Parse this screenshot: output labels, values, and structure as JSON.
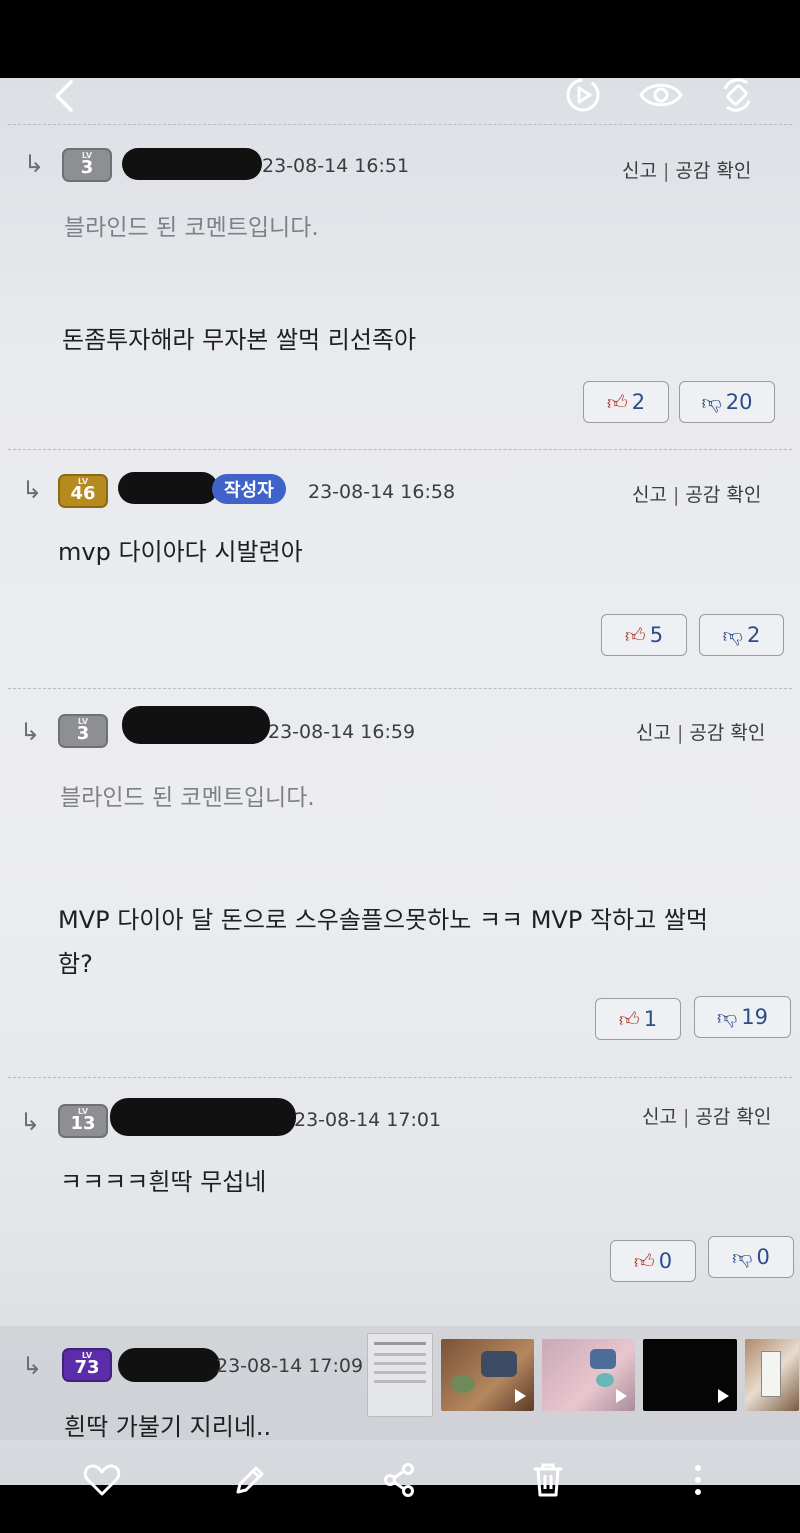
{
  "gallery": {
    "icons": [
      "back-icon",
      "motion-photo-icon",
      "eye-icon",
      "auto-rotate-icon"
    ],
    "bottom_icons": [
      "heart-icon",
      "edit-icon",
      "share-icon",
      "trash-icon",
      "more-icon"
    ]
  },
  "comments": [
    {
      "level": "3",
      "date": "23-08-14 16:51",
      "report": "신고",
      "sympathy": "공감 확인",
      "blinded": "블라인드 된 코멘트입니다.",
      "text": "돈좀투자해라 무자본 쌀먹 리선족아",
      "up": "2",
      "down": "20"
    },
    {
      "level": "46",
      "author_tag": "작성자",
      "date": "23-08-14 16:58",
      "report": "신고",
      "sympathy": "공감 확인",
      "text": "mvp 다이아다 시발련아",
      "up": "5",
      "down": "2"
    },
    {
      "level": "3",
      "date": "23-08-14 16:59",
      "report": "신고",
      "sympathy": "공감 확인",
      "blinded": "블라인드 된 코멘트입니다.",
      "text_line1": "MVP 다이아 달 돈으로 스우솔플으못하노 ㅋㅋ MVP 작하고 쌀먹",
      "text_line2": "함?",
      "up": "1",
      "down": "19"
    },
    {
      "level": "13",
      "date": "23-08-14 17:01",
      "report": "신고",
      "sympathy": "공감 확인",
      "text": "ㅋㅋㅋㅋ흰딱 무섭네",
      "up": "0",
      "down": "0"
    },
    {
      "level": "73",
      "date": "23-08-14 17:09",
      "text": "흰딱 가불기 지리네.."
    }
  ],
  "colors": {
    "author_tag": "#3f63c9",
    "thumb_up": "#b03a2e",
    "thumb_down": "#2c4d8a"
  }
}
